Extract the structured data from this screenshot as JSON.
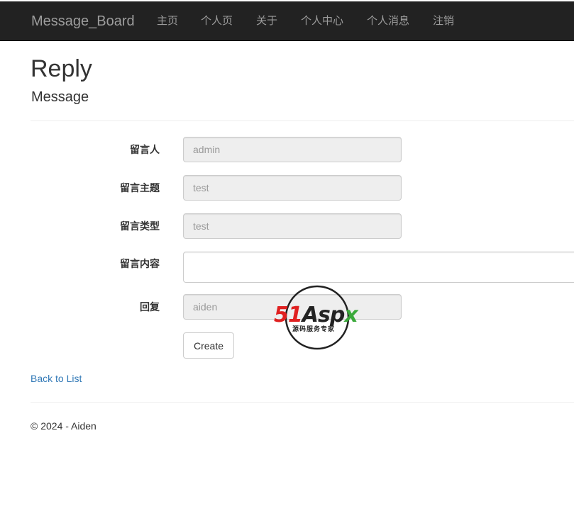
{
  "navbar": {
    "brand": "Message_Board",
    "items": [
      {
        "label": "主页"
      },
      {
        "label": "个人页"
      },
      {
        "label": "关于"
      },
      {
        "label": "个人中心"
      },
      {
        "label": "个人消息"
      },
      {
        "label": "注销"
      }
    ]
  },
  "page": {
    "title": "Reply",
    "subtitle": "Message"
  },
  "form": {
    "fields": [
      {
        "label": "留言人",
        "value": "admin"
      },
      {
        "label": "留言主题",
        "value": "test"
      },
      {
        "label": "留言类型",
        "value": "test"
      },
      {
        "label": "留言内容",
        "value": ""
      },
      {
        "label": "回复",
        "value": "aiden"
      }
    ],
    "submit_label": "Create"
  },
  "back_link": "Back to List",
  "footer": "© 2024 - Aiden",
  "watermark": {
    "main_51": "51",
    "main_asp": "Asp",
    "main_x": "x",
    "sub": "源码服务专家"
  },
  "colors": {
    "navbar_bg": "#222222",
    "nav_text": "#9d9d9d",
    "link": "#337ab7",
    "watermark_red": "#e02020",
    "watermark_green": "#3aa93a"
  }
}
